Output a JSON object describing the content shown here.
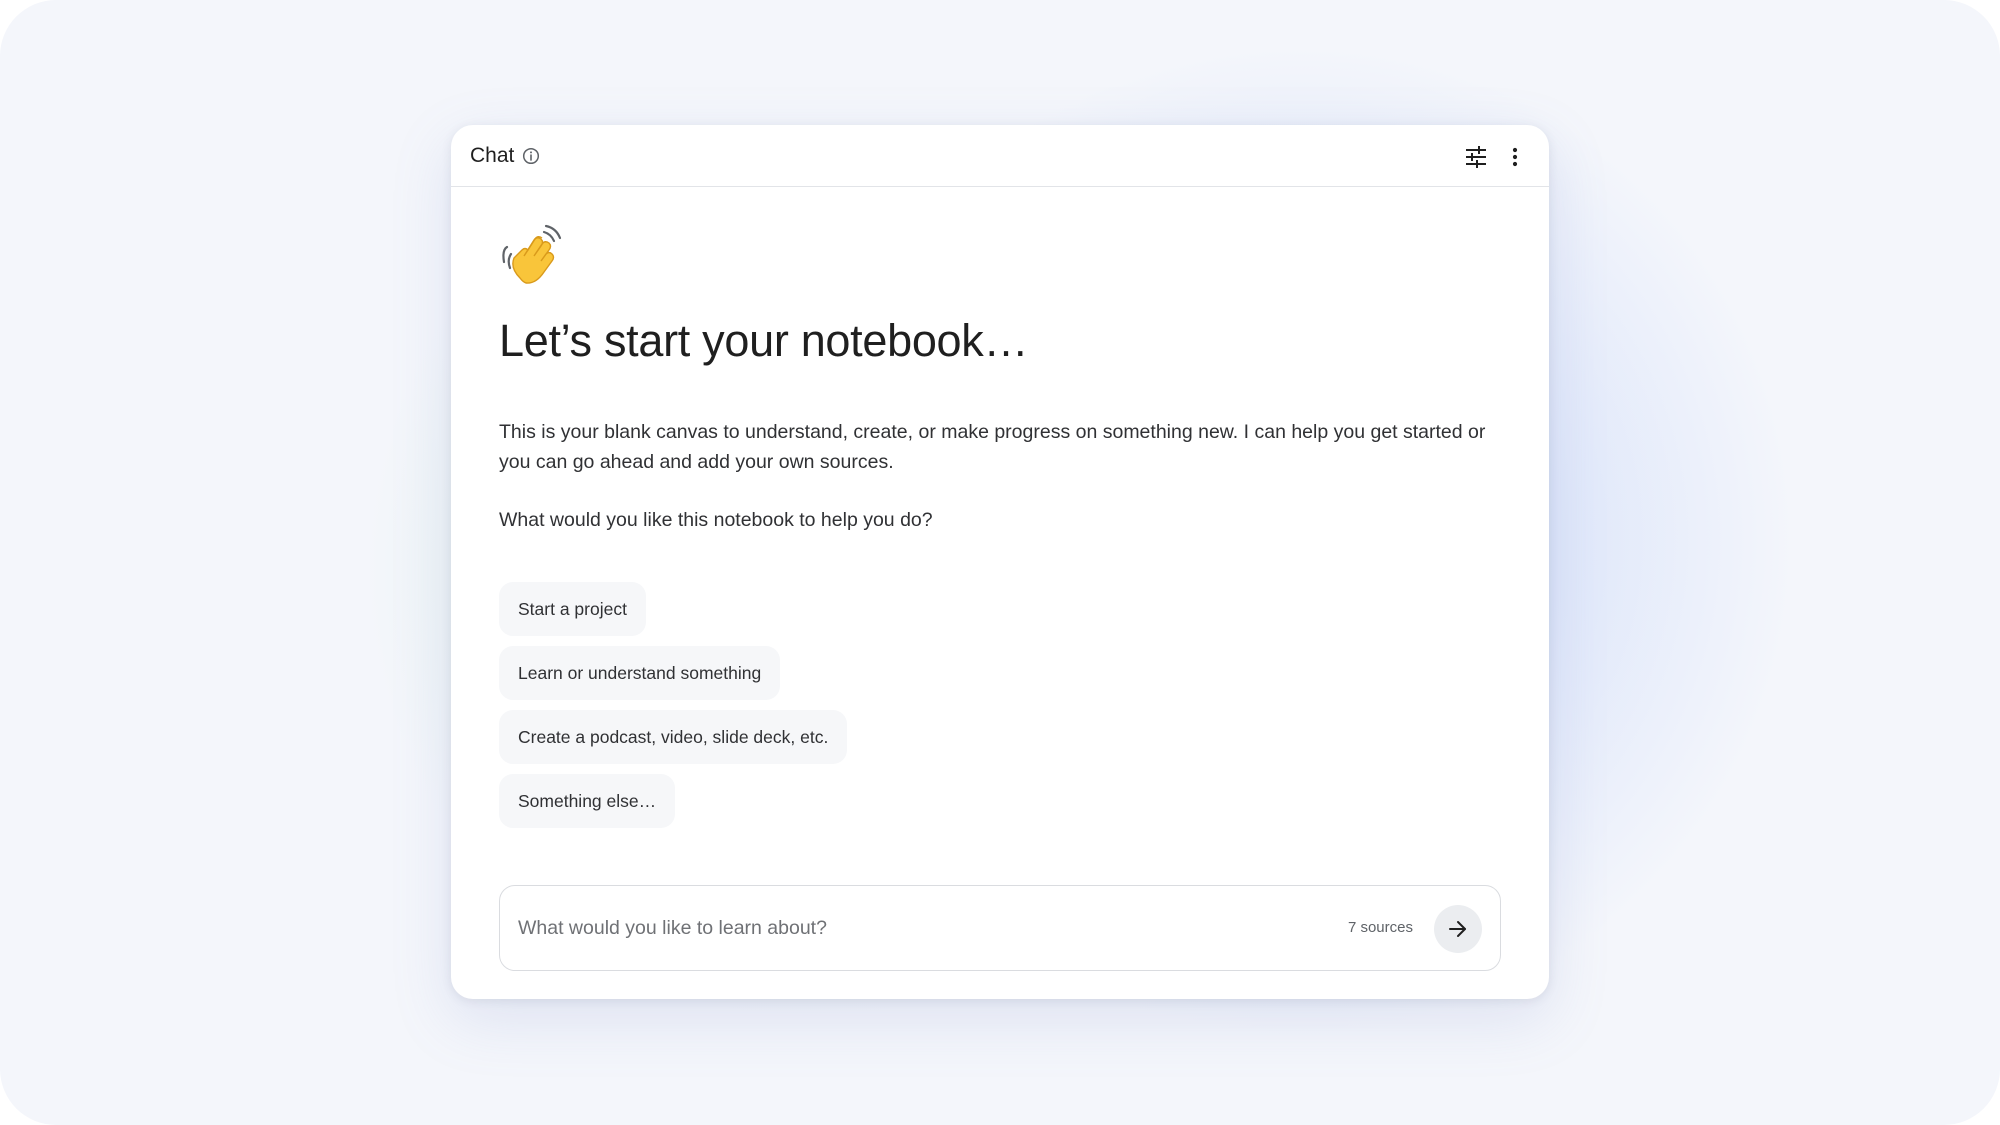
{
  "header": {
    "title": "Chat",
    "icons": [
      "info-icon",
      "tune-icon",
      "more-vert-icon"
    ]
  },
  "welcome": {
    "emoji": "waving-hand-icon",
    "heading": "Let’s start your notebook…",
    "description": "This is your blank canvas to understand, create, or make progress on something new. I can help you get started or you can go ahead and add your own sources.",
    "question": "What would you like this notebook to help you do?"
  },
  "suggestions": [
    {
      "label": "Start a project"
    },
    {
      "label": "Learn or understand something"
    },
    {
      "label": "Create a podcast, video, slide deck, etc."
    },
    {
      "label": "Something else…"
    }
  ],
  "composer": {
    "placeholder": "What would you like to learn about?",
    "sources_label": "7 sources",
    "send_icon": "arrow-forward-icon"
  },
  "colors": {
    "text_primary": "#1f1f1f",
    "text_secondary": "#303134",
    "chip_background": "#f6f7f9",
    "send_button_background": "#ebedf0",
    "wave_emoji": "#f9c53a"
  }
}
